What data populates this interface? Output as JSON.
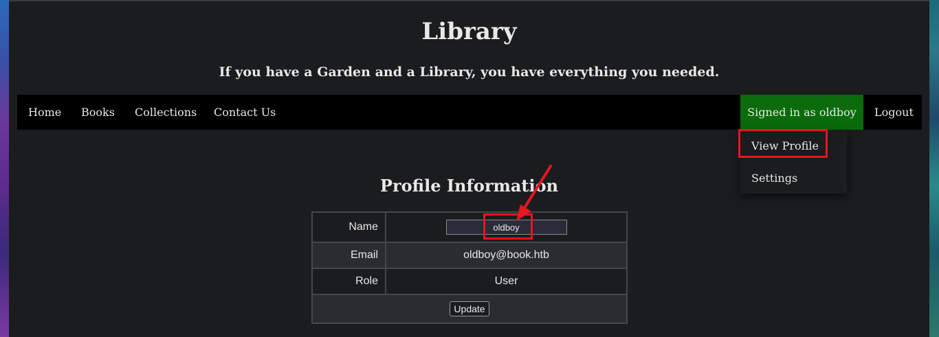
{
  "header": {
    "title": "Library",
    "tagline": "If you have a Garden and a Library, you have everything you needed."
  },
  "nav": {
    "home": "Home",
    "books": "Books",
    "collections": "Collections",
    "contact": "Contact Us",
    "signed_in": "Signed in as oldboy",
    "logout": "Logout"
  },
  "dropdown": {
    "view_profile": "View Profile",
    "settings": "Settings"
  },
  "profile": {
    "title": "Profile Information",
    "name_label": "Name",
    "name_value": "oldboy",
    "email_label": "Email",
    "email_value": "oldboy@book.htb",
    "role_label": "Role",
    "role_value": "User",
    "update_label": "Update"
  },
  "annotations": {
    "highlight_color": "#e8161e",
    "arrow_color": "#e8161e"
  },
  "colors": {
    "background": "#1b1c1e",
    "navbar": "#000000",
    "signed_in_bg": "#0a6b0a"
  }
}
